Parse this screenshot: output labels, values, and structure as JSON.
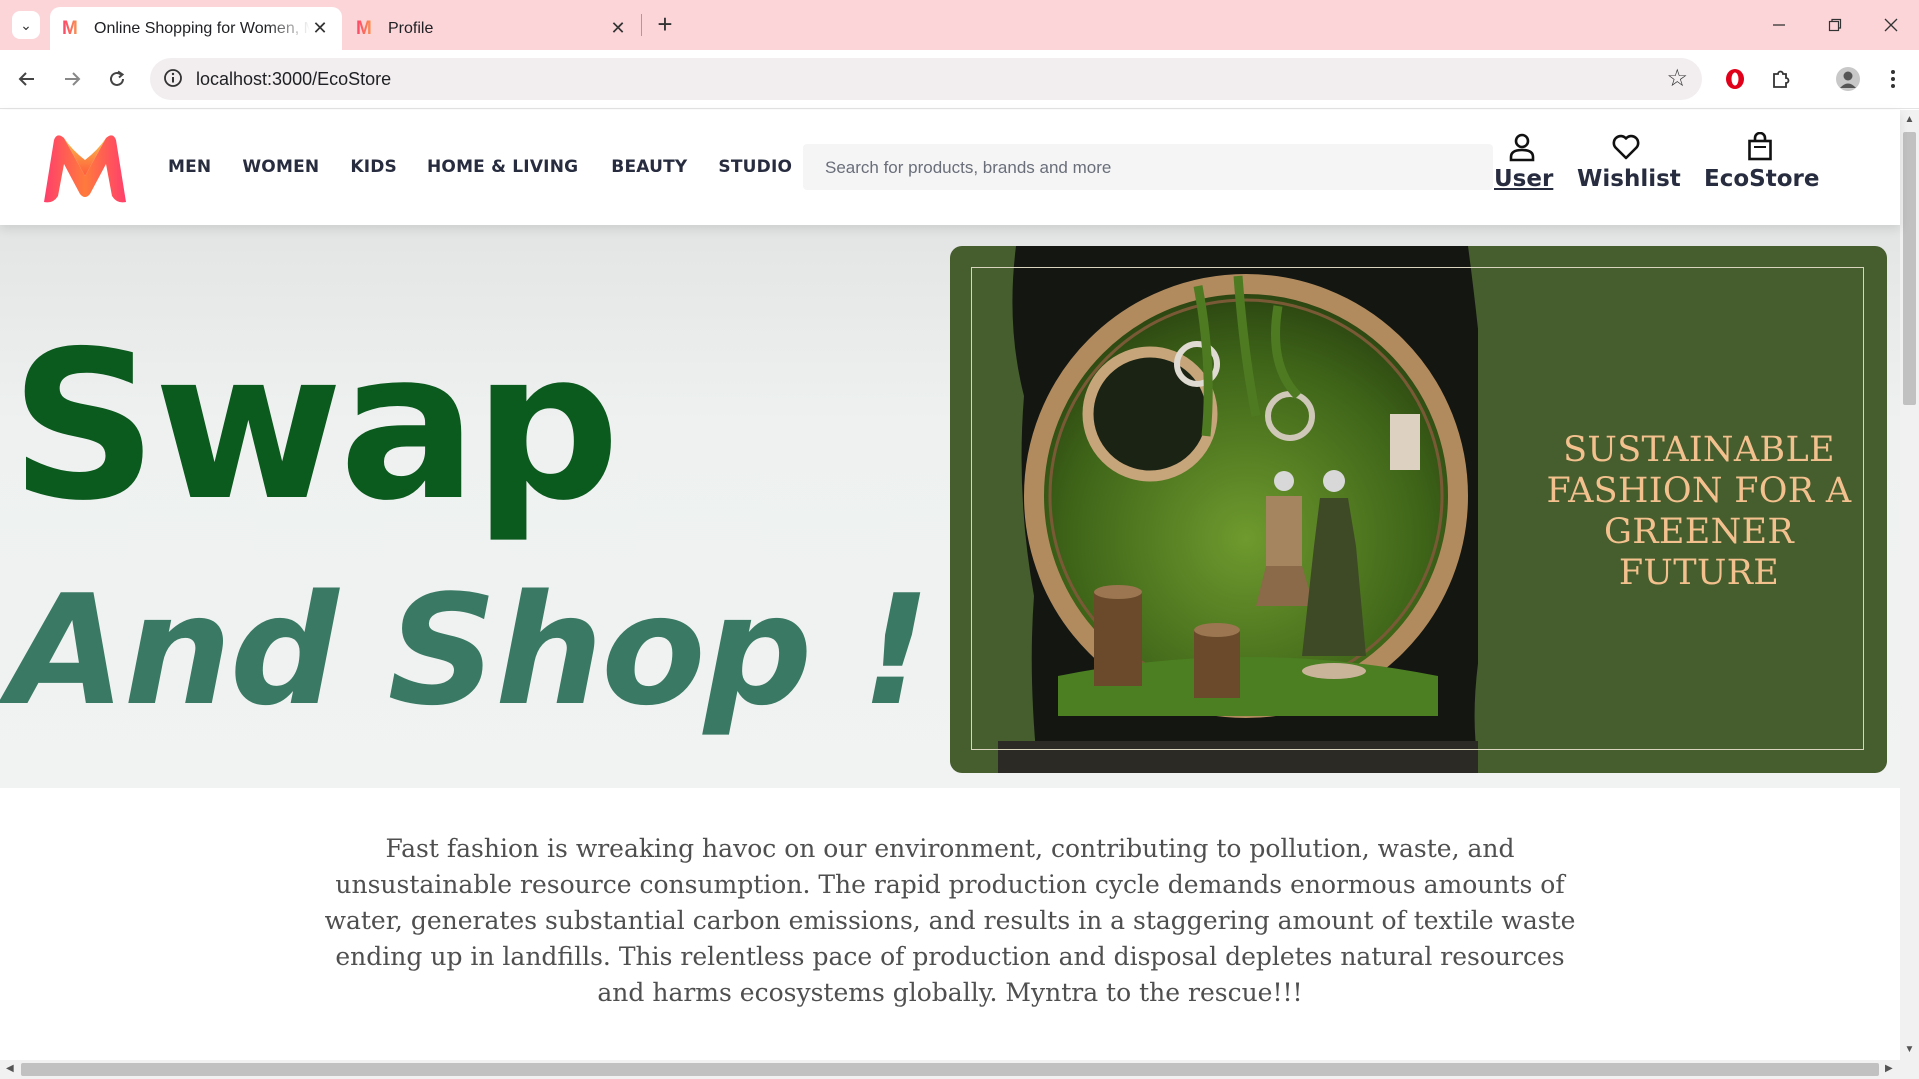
{
  "browser": {
    "tabs": [
      {
        "title": "Online Shopping for Women, Men, Kids",
        "active": true,
        "favicon": "myntra-logo-icon"
      },
      {
        "title": "Profile",
        "active": false,
        "favicon": "myntra-logo-icon"
      }
    ],
    "new_tab": "+",
    "url": "localhost:3000/EcoStore",
    "window_controls": [
      "minimize-icon",
      "restore-icon",
      "close-icon"
    ]
  },
  "site": {
    "logo": "M",
    "nav": [
      "MEN",
      "WOMEN",
      "KIDS",
      "HOME & LIVING",
      "BEAUTY",
      "STUDIO"
    ],
    "search_placeholder": "Search for products, brands and more",
    "actions": [
      {
        "label": "User",
        "icon": "user-icon",
        "underlined": true
      },
      {
        "label": "Wishlist",
        "icon": "heart-icon",
        "underlined": false
      },
      {
        "label": "EcoStore",
        "icon": "bag-icon",
        "underlined": false
      }
    ]
  },
  "hero": {
    "headline": "Swap",
    "subheadline": "And Shop !",
    "banner_text": "SUSTAINABLE FASHION FOR A GREENER FUTURE"
  },
  "description": "Fast fashion is wreaking havoc on our environment, contributing to pollution, waste, and unsustainable resource consumption. The rapid production cycle demands enormous amounts of water, generates substantial carbon emissions, and results in a staggering amount of textile waste ending up in landfills. This relentless pace of production and disposal depletes natural resources and harms ecosystems globally. Myntra to the rescue!!!",
  "colors": {
    "tab_strip": "#fcd5d9",
    "swap_green": "#0b5a1e",
    "andshop_teal": "#3a7a64",
    "banner_green": "#465d2e",
    "banner_text": "#f3c18e",
    "nav_text": "#282c3f"
  }
}
